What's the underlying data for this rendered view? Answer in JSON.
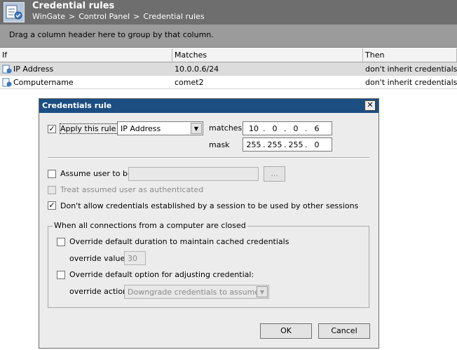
{
  "header": {
    "title": "Credential rules",
    "breadcrumb": [
      "WinGate",
      "Control Panel",
      "Credential rules"
    ],
    "breadcrumb_sep": ">"
  },
  "groupbar": {
    "hint": "Drag a column header here to group by that column."
  },
  "grid": {
    "columns": [
      "If",
      "Matches",
      "Then"
    ],
    "rows": [
      {
        "if": "IP Address",
        "matches": "10.0.0.6/24",
        "then": "don't inherit credentials",
        "selected": true
      },
      {
        "if": "Computername",
        "matches": "comet2",
        "then": "don't inherit credentials",
        "selected": false
      }
    ]
  },
  "dialog": {
    "title": "Credentials rule",
    "close_glyph": "✕",
    "apply_rule": {
      "label": "Apply this rule if",
      "checked": true,
      "checkmark": "✓"
    },
    "rule_type": {
      "value": "IP Address",
      "arrow": "▼"
    },
    "matches_label": "matches",
    "matches_ip": [
      "10",
      "0",
      "0",
      "6"
    ],
    "mask_label": "mask",
    "mask_ip": [
      "255",
      "255",
      "255",
      "0"
    ],
    "ip_dot": ".",
    "assume_user": {
      "label": "Assume user to be",
      "checked": false,
      "browse": "..."
    },
    "treat_authenticated": {
      "label": "Treat assumed user as authenticated",
      "checked": false
    },
    "dont_allow": {
      "label": "Don't allow credentials established by a session to be used by other sessions",
      "checked": true,
      "checkmark": "✓"
    },
    "group": {
      "legend": "When all connections from a computer are closed",
      "override_duration": {
        "label": "Override default duration to maintain cached credentials",
        "checked": false
      },
      "override_value_label": "override value:",
      "override_value": "30",
      "override_option": {
        "label": "Override default option for adjusting credential:",
        "checked": false
      },
      "override_action_label": "override action",
      "override_action": {
        "value": "Downgrade credentials to assumed",
        "arrow": "▼"
      }
    },
    "ok": "OK",
    "cancel": "Cancel"
  }
}
